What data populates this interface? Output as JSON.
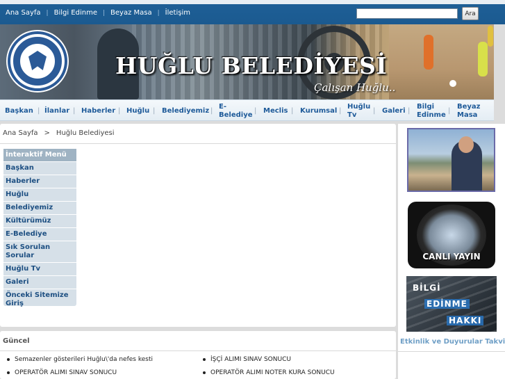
{
  "topnav": {
    "items": [
      "Ana Sayfa",
      "Bilgi Edinme",
      "Beyaz Masa",
      "İletişim"
    ],
    "search_button": "Ara",
    "search_value": ""
  },
  "banner": {
    "title": "HUĞLU BELEDİYESİ",
    "slogan": "Çalışan Huğlu.."
  },
  "mainnav": {
    "items": [
      "Başkan",
      "İlanlar",
      "Haberler",
      "Huğlu",
      "Belediyemiz",
      "E-Belediye",
      "Meclis",
      "Kurumsal",
      "Huğlu Tv",
      "Galeri",
      "Bilgi Edinme",
      "Beyaz Masa"
    ]
  },
  "breadcrumb": {
    "home": "Ana Sayfa",
    "separator": ">",
    "current": "Huğlu Belediyesi"
  },
  "sidemenu": {
    "title": "İnteraktif Menü",
    "items": [
      "Başkan",
      "Haberler",
      "Huğlu",
      "Belediyemiz",
      "Kültürümüz",
      "E-Belediye",
      "Sık Sorulan Sorular",
      "Huğlu Tv",
      "Galeri",
      "Önceki Sitemize Giriş"
    ]
  },
  "right": {
    "live_label": "CANLI YAYIN",
    "info_words": [
      "BİLGİ",
      "EDİNME",
      "HAKKI"
    ],
    "events_title": "Etkinlik ve Duyurular Takvimi"
  },
  "news": {
    "title": "Güncel",
    "items": [
      "Semazenler gösterileri Huğlu\\'da nefes kesti",
      "İŞÇİ ALIMI SINAV SONUCU",
      "OPERATÖR ALIMI SINAV SONUCU",
      "OPERATÖR ALIMI NOTER KURA SONUCU"
    ]
  },
  "colors": {
    "topbar": "#1e5f96",
    "nav_text": "#1e5a99",
    "menu_title_bg": "#9fb3c3",
    "menu_bg": "#d6e0e8"
  }
}
